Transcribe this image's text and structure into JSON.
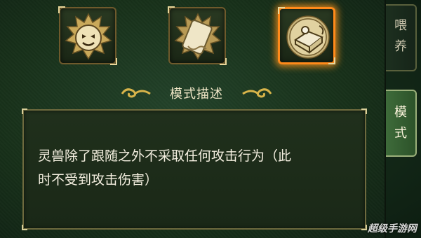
{
  "mode_icons": [
    {
      "name": "follow-mode",
      "selected": false
    },
    {
      "name": "scroll-mode",
      "selected": false
    },
    {
      "name": "passive-mode",
      "selected": true
    }
  ],
  "section_title": "模式描述",
  "description": {
    "line1": "灵兽除了跟随之外不采取任何攻击行为（此",
    "line2": "时不受到攻击伤害）"
  },
  "side_tabs": [
    {
      "label_line1": "喂",
      "label_line2": "养",
      "active": false
    },
    {
      "label_line1": "模",
      "label_line2": "式",
      "active": true
    }
  ],
  "watermark": "超级手游网",
  "colors": {
    "selected_glow": "#ff8a1a",
    "text": "#f4efe0",
    "frame": "#6e6a3e"
  }
}
